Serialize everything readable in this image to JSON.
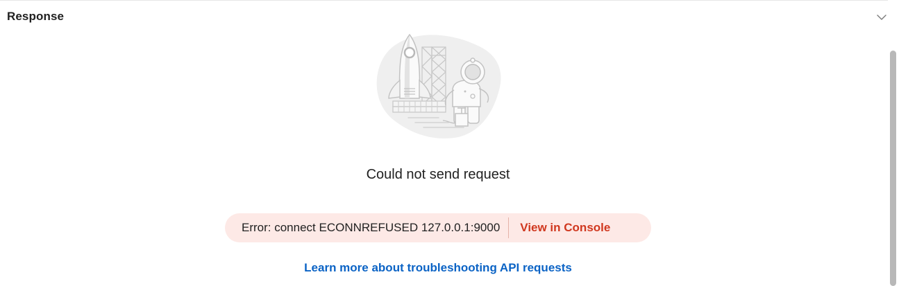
{
  "header": {
    "title": "Response",
    "collapse_icon": "chevron-down-icon"
  },
  "illustration": {
    "icon": "rocket-astronaut-illustration"
  },
  "main": {
    "message": "Could not send request",
    "error": {
      "text": "Error: connect ECONNREFUSED 127.0.0.1:9000",
      "console_link": "View in Console"
    },
    "help_link": "Learn more about troubleshooting API requests"
  },
  "colors": {
    "error_background": "#fde9e6",
    "error_link": "#d0381f",
    "help_link": "#0b63c5"
  }
}
